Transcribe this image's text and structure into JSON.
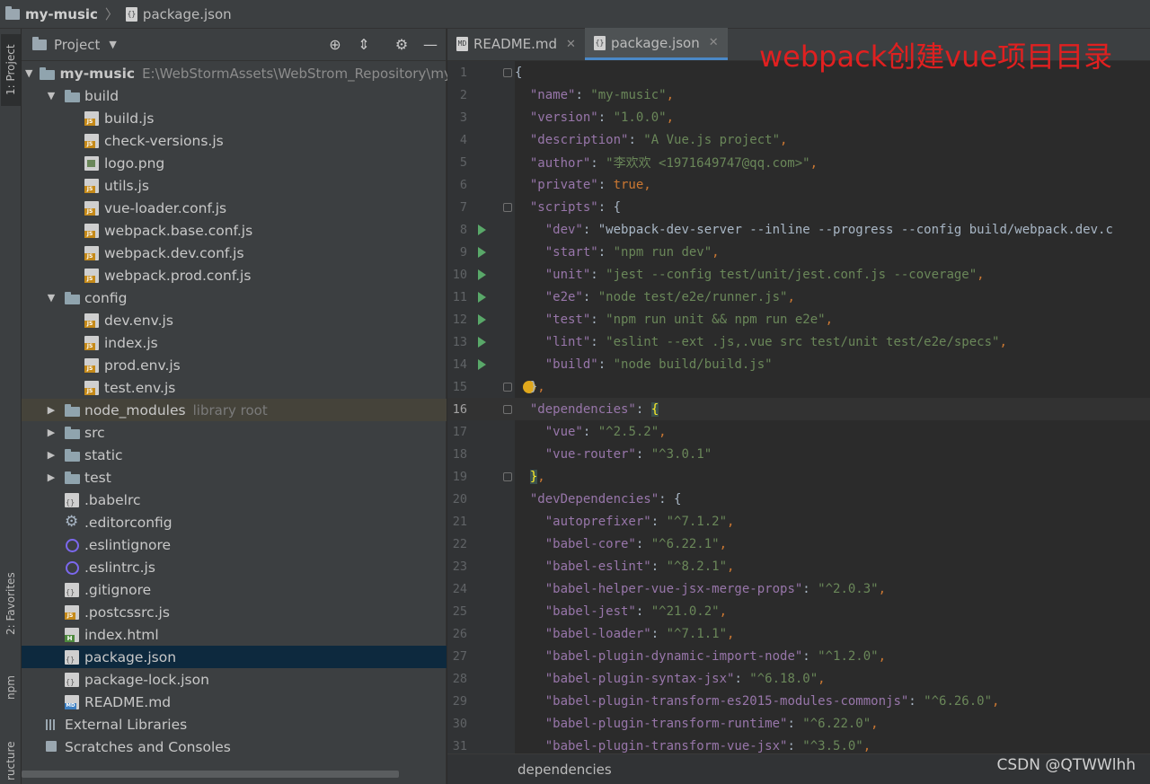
{
  "titlebar": {
    "project": "my-music",
    "file": "package.json"
  },
  "leftbar": {
    "project_tab": "1: Project",
    "favorites_tab": "2: Favorites",
    "npm_tab": "npm",
    "structure_tab": "ructure"
  },
  "project_panel": {
    "title": "Project",
    "tree": [
      {
        "label": "my-music",
        "extra": "E:\\WebStormAssets\\WebStrom_Repository\\my",
        "icon": "folder",
        "indent": 0,
        "arrow": "down",
        "bold": true
      },
      {
        "label": "build",
        "icon": "folder",
        "indent": 1,
        "arrow": "down"
      },
      {
        "label": "build.js",
        "icon": "js",
        "indent": 2
      },
      {
        "label": "check-versions.js",
        "icon": "js",
        "indent": 2
      },
      {
        "label": "logo.png",
        "icon": "img",
        "indent": 2
      },
      {
        "label": "utils.js",
        "icon": "js",
        "indent": 2
      },
      {
        "label": "vue-loader.conf.js",
        "icon": "js",
        "indent": 2
      },
      {
        "label": "webpack.base.conf.js",
        "icon": "js",
        "indent": 2
      },
      {
        "label": "webpack.dev.conf.js",
        "icon": "js",
        "indent": 2
      },
      {
        "label": "webpack.prod.conf.js",
        "icon": "js",
        "indent": 2
      },
      {
        "label": "config",
        "icon": "folder",
        "indent": 1,
        "arrow": "down"
      },
      {
        "label": "dev.env.js",
        "icon": "js",
        "indent": 2
      },
      {
        "label": "index.js",
        "icon": "js",
        "indent": 2
      },
      {
        "label": "prod.env.js",
        "icon": "js",
        "indent": 2
      },
      {
        "label": "test.env.js",
        "icon": "js",
        "indent": 2
      },
      {
        "label": "node_modules",
        "extra": "library root",
        "icon": "folder",
        "indent": 1,
        "arrow": "right",
        "highlight": true
      },
      {
        "label": "src",
        "icon": "folder",
        "indent": 1,
        "arrow": "right"
      },
      {
        "label": "static",
        "icon": "folder",
        "indent": 1,
        "arrow": "right"
      },
      {
        "label": "test",
        "icon": "folder",
        "indent": 1,
        "arrow": "right"
      },
      {
        "label": ".babelrc",
        "icon": "json",
        "indent": 1
      },
      {
        "label": ".editorconfig",
        "icon": "gear",
        "indent": 1
      },
      {
        "label": ".eslintignore",
        "icon": "eslint",
        "indent": 1
      },
      {
        "label": ".eslintrc.js",
        "icon": "eslint",
        "indent": 1
      },
      {
        "label": ".gitignore",
        "icon": "json",
        "indent": 1
      },
      {
        "label": ".postcssrc.js",
        "icon": "js",
        "indent": 1
      },
      {
        "label": "index.html",
        "icon": "html",
        "indent": 1
      },
      {
        "label": "package.json",
        "icon": "json",
        "indent": 1,
        "selected": true
      },
      {
        "label": "package-lock.json",
        "icon": "json",
        "indent": 1
      },
      {
        "label": "README.md",
        "icon": "md",
        "indent": 1
      },
      {
        "label": "External Libraries",
        "icon": "lib",
        "indent": 0
      },
      {
        "label": "Scratches and Consoles",
        "icon": "scr",
        "indent": 0
      }
    ]
  },
  "editor": {
    "tabs": [
      {
        "label": "README.md",
        "active": false
      },
      {
        "label": "package.json",
        "active": true
      }
    ],
    "overlay_text": "webpack创建vue项目目录",
    "breadcrumb": "dependencies",
    "watermark": "CSDN @QTWWlhh",
    "lines": [
      {
        "n": "1",
        "code": "{"
      },
      {
        "n": "2",
        "code": "  \"name\": \"my-music\","
      },
      {
        "n": "3",
        "code": "  \"version\": \"1.0.0\","
      },
      {
        "n": "4",
        "code": "  \"description\": \"A Vue.js project\","
      },
      {
        "n": "5",
        "code": "  \"author\": \"李欢欢 <1971649747@qq.com>\","
      },
      {
        "n": "6",
        "code": "  \"private\": true,"
      },
      {
        "n": "7",
        "code": "  \"scripts\": {"
      },
      {
        "n": "8",
        "code": "    \"dev\": \"webpack-dev-server --inline --progress --config build/webpack.dev.c"
      },
      {
        "n": "9",
        "code": "    \"start\": \"npm run dev\","
      },
      {
        "n": "10",
        "code": "    \"unit\": \"jest --config test/unit/jest.conf.js --coverage\","
      },
      {
        "n": "11",
        "code": "    \"e2e\": \"node test/e2e/runner.js\","
      },
      {
        "n": "12",
        "code": "    \"test\": \"npm run unit && npm run e2e\","
      },
      {
        "n": "13",
        "code": "    \"lint\": \"eslint --ext .js,.vue src test/unit test/e2e/specs\","
      },
      {
        "n": "14",
        "code": "    \"build\": \"node build/build.js\""
      },
      {
        "n": "15",
        "code": "  },"
      },
      {
        "n": "16",
        "code": "  \"dependencies\": {"
      },
      {
        "n": "17",
        "code": "    \"vue\": \"^2.5.2\","
      },
      {
        "n": "18",
        "code": "    \"vue-router\": \"^3.0.1\""
      },
      {
        "n": "19",
        "code": "  },"
      },
      {
        "n": "20",
        "code": "  \"devDependencies\": {"
      },
      {
        "n": "21",
        "code": "    \"autoprefixer\": \"^7.1.2\","
      },
      {
        "n": "22",
        "code": "    \"babel-core\": \"^6.22.1\","
      },
      {
        "n": "23",
        "code": "    \"babel-eslint\": \"^8.2.1\","
      },
      {
        "n": "24",
        "code": "    \"babel-helper-vue-jsx-merge-props\": \"^2.0.3\","
      },
      {
        "n": "25",
        "code": "    \"babel-jest\": \"^21.0.2\","
      },
      {
        "n": "26",
        "code": "    \"babel-loader\": \"^7.1.1\","
      },
      {
        "n": "27",
        "code": "    \"babel-plugin-dynamic-import-node\": \"^1.2.0\","
      },
      {
        "n": "28",
        "code": "    \"babel-plugin-syntax-jsx\": \"^6.18.0\","
      },
      {
        "n": "29",
        "code": "    \"babel-plugin-transform-es2015-modules-commonjs\": \"^6.26.0\","
      },
      {
        "n": "30",
        "code": "    \"babel-plugin-transform-runtime\": \"^6.22.0\","
      },
      {
        "n": "31",
        "code": "    \"babel-plugin-transform-vue-jsx\": \"^3.5.0\","
      }
    ],
    "run_lines": [
      "8",
      "9",
      "10",
      "11",
      "12",
      "13",
      "14"
    ],
    "current_line": "16"
  }
}
